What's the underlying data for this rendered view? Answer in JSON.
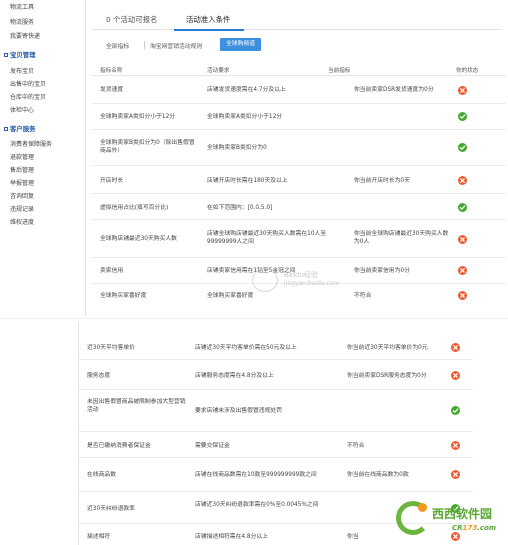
{
  "colors": {
    "accent": "#2b7bd6",
    "fail": "#ec5b2f",
    "pass": "#43a92e",
    "watermark_green": "#5aa832",
    "watermark_orange": "#f29a1f"
  },
  "sidebar": {
    "links_top": [
      "物流工具",
      "物流服务",
      "我要寄快递"
    ],
    "section1": {
      "title": "宝贝管理",
      "items": [
        "发布宝贝",
        "出售中的宝贝",
        "仓库中的宝贝",
        "体检中心"
      ]
    },
    "section2": {
      "title": "客户服务",
      "items": [
        "消费者保障服务",
        "退款管理",
        "售后管理",
        "举报管理",
        "咨询回复",
        "违规记录",
        "维权进度"
      ]
    }
  },
  "tabs": [
    {
      "label": "0 个活动可报名"
    },
    {
      "label": "活动准入条件"
    }
  ],
  "subnav": [
    {
      "label": "全部指标"
    },
    {
      "label": "淘宝网营销活动规则"
    },
    {
      "label": "全球购频道"
    }
  ],
  "table": {
    "headers": [
      "指标名称",
      "活动要求",
      "当前指标",
      "你的状态"
    ],
    "rows": [
      {
        "name": "发货速度",
        "req": "店铺发货速度需在4.7分及以上",
        "cur": "你当前卖家DSR发货速度为0分",
        "status": "fail"
      },
      {
        "name": "全球购卖家A类扣分小于12分",
        "req": "全球购卖家A类扣分小于12分",
        "cur": "",
        "status": "pass"
      },
      {
        "name": "全球购卖家B类扣分为0（除出售假冒商品外）",
        "req": "全球购卖家B类扣分为0",
        "cur": "",
        "status": "pass"
      },
      {
        "name": "开店时长",
        "req": "店铺开店时长需在180天及以上",
        "cur": "你当前开店时长为0天",
        "status": "fail"
      },
      {
        "name": "虚拟信用占比(填写百分比)",
        "req": "在如下范围内：[0.0,5.0]",
        "cur": "",
        "status": "pass"
      },
      {
        "name": "全球购店铺最近30天购买人数",
        "req": "店铺全球购店铺最近30天购买人数需在10人至99999999人之间",
        "cur": "你当前全球购店铺最近30天购买人数为0人",
        "status": "fail"
      },
      {
        "name": "卖家信用",
        "req": "店铺卖家信用需在1钻至5金冠之间",
        "cur": "你当前卖家信用为0分",
        "status": "fail"
      },
      {
        "name": "全球购买家喜好度",
        "req": "全球购买家喜好度",
        "cur": "不符合",
        "status": "fail"
      }
    ]
  },
  "table2": {
    "rows": [
      {
        "name": "近30天平均客单价",
        "req": "店铺近30天平均客单价需在50元及以上",
        "cur": "你当前近30天平均客单价为0元",
        "status": "fail"
      },
      {
        "name": "服务态度",
        "req": "店铺服务态度需在4.8分及以上",
        "cur": "你当前卖家DSR服务态度为0分",
        "status": "fail"
      },
      {
        "name": "未因出售假冒商品被限制参加大型营销活动",
        "req": "要求店铺未涉及出售假冒违规处罚",
        "cur": "",
        "status": "pass"
      },
      {
        "name": "是否已缴纳消费者保证金",
        "req": "需要交保证金",
        "cur": "不符合",
        "status": "fail"
      },
      {
        "name": "在线商品数",
        "req": "店铺在线商品数需在10款至999999999款之间",
        "cur": "你当前在线商品数为0款",
        "status": "fail"
      },
      {
        "name": "近30天纠纷退款率",
        "req": "店铺近30天纠纷退款率需在0%至0.0045%之间",
        "cur": "",
        "status": "pass"
      },
      {
        "name": "描述相符",
        "req": "店铺描述相符需在4.8分以上",
        "cur": "你当",
        "status": "fail"
      }
    ]
  },
  "watermark": {
    "cn": "西西软件园",
    "en_left": "CR",
    "en_mid": "173",
    "en_right": ".com"
  },
  "jingyan": {
    "line1": "Baidu经验",
    "line2": "jingyan.baidu.com"
  }
}
